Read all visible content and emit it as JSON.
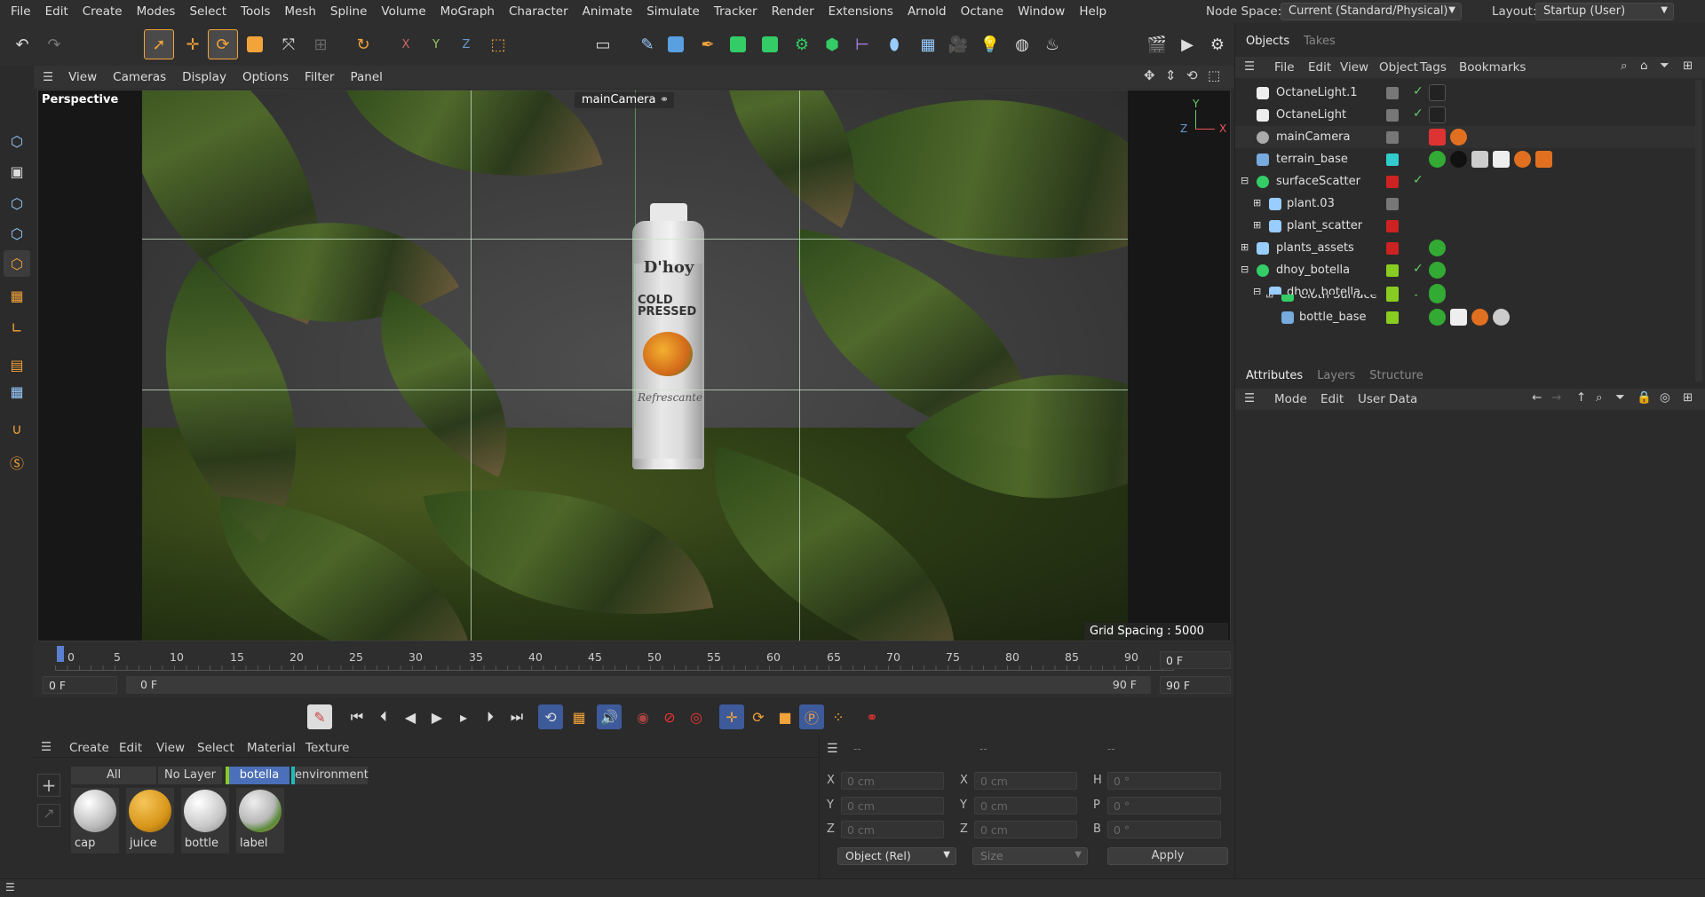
{
  "menubar": {
    "items": [
      "File",
      "Edit",
      "Create",
      "Modes",
      "Select",
      "Tools",
      "Mesh",
      "Spline",
      "Volume",
      "MoGraph",
      "Character",
      "Animate",
      "Simulate",
      "Tracker",
      "Render",
      "Extensions",
      "Arnold",
      "Octane",
      "Window",
      "Help"
    ],
    "node_space_label": "Node Space:",
    "node_space_value": "Current (Standard/Physical)",
    "layout_label": "Layout:",
    "layout_value": "Startup (User)"
  },
  "viewport": {
    "menu": [
      "View",
      "Cameras",
      "Display",
      "Options",
      "Filter",
      "Panel"
    ],
    "view_name": "Perspective",
    "camera_name": "mainCamera",
    "grid_spacing": "Grid Spacing : 5000 cm",
    "bottle": {
      "brand": "D'hoy",
      "line1": "COLD",
      "line2": "PRESSED",
      "tagline": "Refrescante"
    },
    "axis": {
      "y": "Y",
      "z": "Z",
      "x": "X"
    }
  },
  "objects_panel": {
    "tabs": [
      "Objects",
      "Takes"
    ],
    "menu": [
      "File",
      "Edit",
      "View",
      "Object",
      "Tags",
      "Bookmarks"
    ],
    "rows": [
      {
        "name": "OctaneLight.1"
      },
      {
        "name": "OctaneLight"
      },
      {
        "name": "mainCamera"
      },
      {
        "name": "terrain_base"
      },
      {
        "name": "surfaceScatter"
      },
      {
        "name": "plant.03"
      },
      {
        "name": "plant_scatter"
      },
      {
        "name": "plants_assets"
      },
      {
        "name": "dhoy_botella"
      },
      {
        "name": "dhoy_botella"
      },
      {
        "name": "Cloth Surface"
      },
      {
        "name": "bottle_base"
      }
    ]
  },
  "attributes_panel": {
    "tabs": [
      "Attributes",
      "Layers",
      "Structure"
    ],
    "menu": [
      "Mode",
      "Edit",
      "User Data"
    ]
  },
  "timeline": {
    "ticks": [
      "0",
      "5",
      "10",
      "15",
      "20",
      "25",
      "30",
      "35",
      "40",
      "45",
      "50",
      "55",
      "60",
      "65",
      "70",
      "75",
      "80",
      "85",
      "90"
    ],
    "current_frame_right": "0 F",
    "start_field": "0 F",
    "range_start": "0 F",
    "range_end": "90 F",
    "end_field": "90 F"
  },
  "material_manager": {
    "menu": [
      "Create",
      "Edit",
      "View",
      "Select",
      "Material",
      "Texture"
    ],
    "layer_tabs": [
      "All",
      "No Layer",
      "botella",
      "environment"
    ],
    "materials": [
      {
        "name": "cap",
        "color": "#e6e6e6"
      },
      {
        "name": "juice",
        "color": "#e3a020"
      },
      {
        "name": "bottle",
        "color": "#d8d8d8"
      },
      {
        "name": "label",
        "color": "#cfcfcf"
      }
    ]
  },
  "coordinates": {
    "headers": [
      "--",
      "--",
      "--"
    ],
    "rows": [
      [
        "X",
        "0 cm",
        "X",
        "0 cm",
        "H",
        "0 °"
      ],
      [
        "Y",
        "0 cm",
        "Y",
        "0 cm",
        "P",
        "0 °"
      ],
      [
        "Z",
        "0 cm",
        "Z",
        "0 cm",
        "B",
        "0 °"
      ]
    ],
    "mode_select": "Object (Rel)",
    "size_select": "Size",
    "apply_label": "Apply"
  }
}
